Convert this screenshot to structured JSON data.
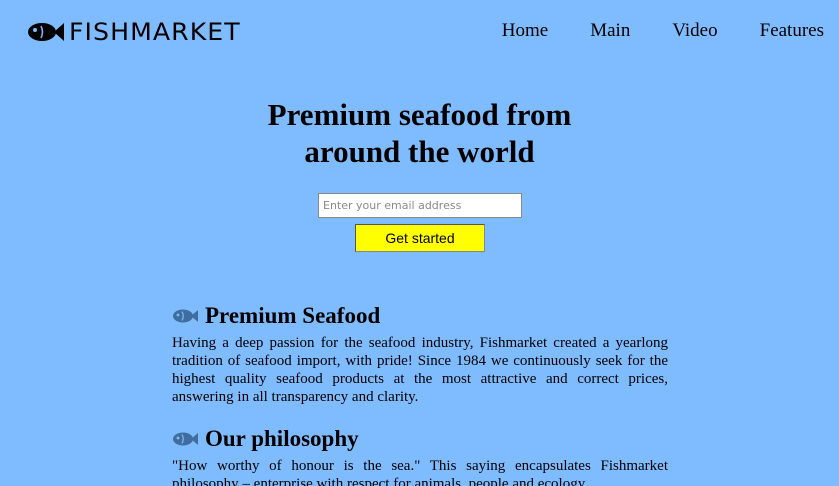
{
  "header": {
    "logo_text": "FISHMARKET",
    "nav": [
      {
        "label": "Home"
      },
      {
        "label": "Main"
      },
      {
        "label": "Video"
      },
      {
        "label": "Features"
      }
    ]
  },
  "hero": {
    "title_line1": "Premium seafood from",
    "title_line2": "around the world",
    "email_placeholder": "Enter your email address",
    "cta_label": "Get started"
  },
  "sections": [
    {
      "title": "Premium Seafood",
      "body": "Having a deep passion for the seafood industry, Fishmarket created a yearlong tradition of seafood import, with pride! Since 1984 we continuously seek for the highest quality seafood products at the most attractive and correct prices, answering in all transparency and clarity."
    },
    {
      "title": "Our philosophy",
      "body": "\"How worthy of honour is the sea.\" This saying encapsulates Fishmarket philosophy – enterprise with respect for animals, people and ecology."
    }
  ],
  "colors": {
    "background": "#7fbcff",
    "cta": "#ffff00",
    "section_icon": "#3f6e9e"
  },
  "icons": {
    "logo_icon": "fish-icon",
    "section_icon": "fish-icon"
  }
}
